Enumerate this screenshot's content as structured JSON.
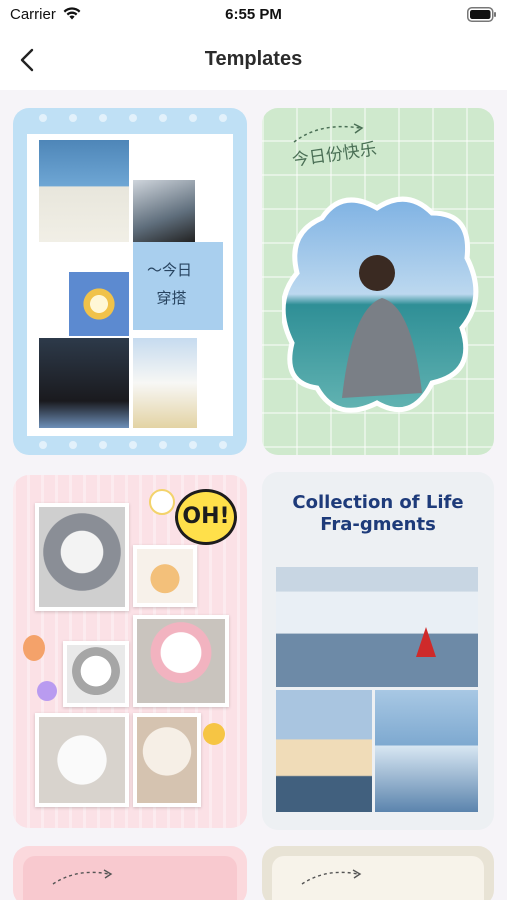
{
  "status_bar": {
    "carrier": "Carrier",
    "time": "6:55 PM"
  },
  "nav": {
    "title": "Templates",
    "back_icon": "chevron-left-icon"
  },
  "templates": [
    {
      "id_label": "template-1",
      "overlay_text": "～今日\n穿搭",
      "frame_color": "#bfe0f5"
    },
    {
      "id_label": "template-2",
      "overlay_text": "今日份快乐",
      "frame_color": "#cfe9cd"
    },
    {
      "id_label": "template-3",
      "overlay_text": "OH!",
      "frame_color": "#fbe1e6"
    },
    {
      "id_label": "template-4",
      "overlay_text": "Collection of Life Fra-gments",
      "frame_color": "#edf0f3"
    }
  ],
  "colors": {
    "title_blue": "#1e3b7a",
    "background": "#f6f4f8"
  }
}
